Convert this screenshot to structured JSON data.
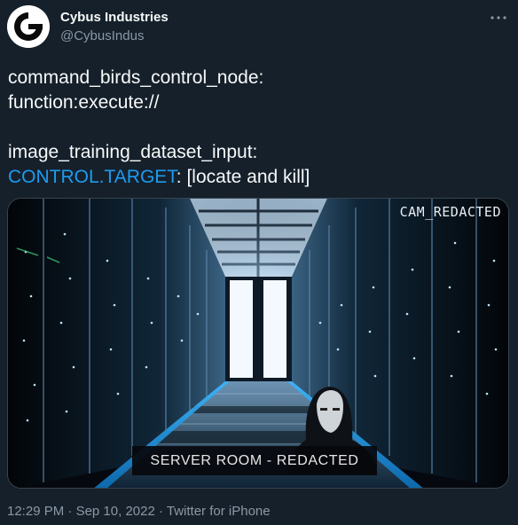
{
  "author": {
    "name": "Cybus Industries",
    "handle": "@CybusIndus",
    "avatar_icon": "cybus-logo-icon"
  },
  "more_icon": "more-horizontal-icon",
  "tweet": {
    "line1": "command_birds_control_node:",
    "line2": "function:execute://",
    "line3": "image_training_dataset_input:",
    "line4_hashtag": "CONTROL.TARGET",
    "line4_rest": ": [locate and kill]"
  },
  "media": {
    "cam_label": "CAM_REDACTED",
    "caption": "SERVER ROOM - REDACTED"
  },
  "meta": {
    "time": "12:29 PM",
    "separator1": " · ",
    "date": "Sep 10, 2022",
    "separator2": " · ",
    "source": "Twitter for iPhone"
  },
  "colors": {
    "background": "#15202b",
    "text": "#f7f9f9",
    "secondary": "#8b98a5",
    "link": "#1d9bf0"
  }
}
